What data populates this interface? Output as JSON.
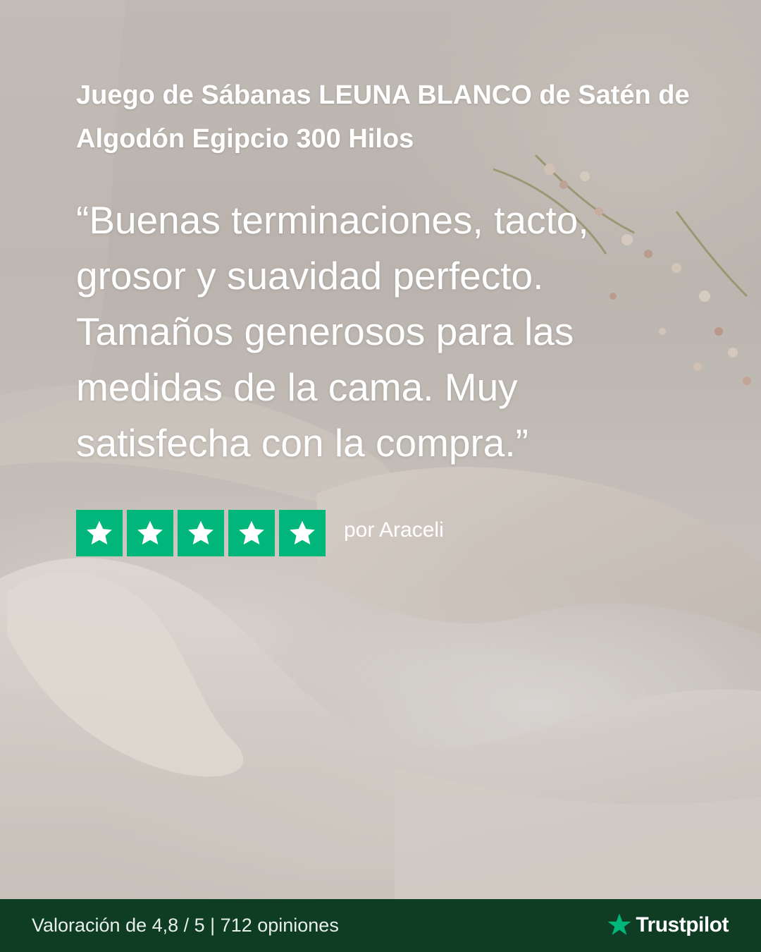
{
  "product": {
    "title": "Juego de Sábanas LEUNA BLANCO de Satén de Algodón Egipcio 300 Hilos"
  },
  "review": {
    "quote": "“Buenas terminaciones, tacto, grosor y suavidad perfecto. Tamaños generosos para las medidas de la cama. Muy satisfecha con la compra.”",
    "stars": 5,
    "star_icon": "star-icon",
    "author": "por Araceli"
  },
  "footer": {
    "summary": "Valoración de 4,8 / 5 | 712 opiniones",
    "brand_name": "Trustpilot",
    "brand_icon": "trustpilot-star-icon"
  },
  "colors": {
    "trustpilot_green": "#00b67a",
    "footer_bg": "#0e3d24",
    "text": "#ffffff"
  }
}
